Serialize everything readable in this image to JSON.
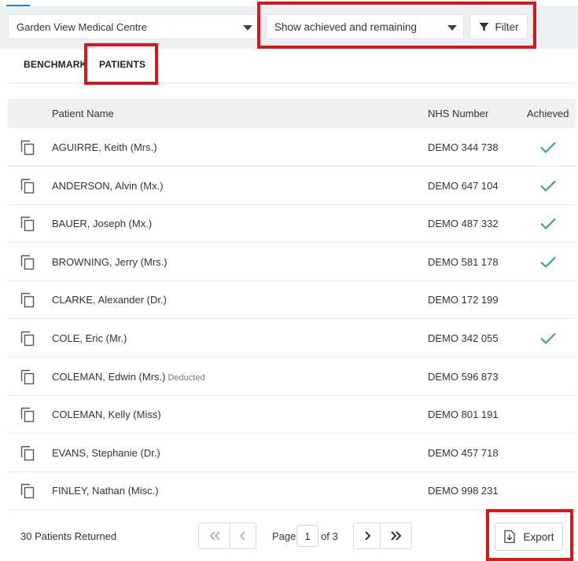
{
  "toolbar": {
    "practice": "Garden View Medical Centre",
    "achieved_filter": "Show achieved and remaining",
    "filter_label": "Filter"
  },
  "tabs": [
    {
      "label": "BENCHMARK"
    },
    {
      "label": "PATIENTS"
    }
  ],
  "table": {
    "columns": [
      "Patient Name",
      "NHS Number",
      "Achieved"
    ],
    "rows": [
      {
        "name": "AGUIRRE, Keith (Mrs.)",
        "note": "",
        "nhs": "DEMO 344 738",
        "achieved": true
      },
      {
        "name": "ANDERSON, Alvin (Mx.)",
        "note": "",
        "nhs": "DEMO 647 104",
        "achieved": true
      },
      {
        "name": "BAUER, Joseph (Mx.)",
        "note": "",
        "nhs": "DEMO 487 332",
        "achieved": true
      },
      {
        "name": "BROWNING, Jerry (Mrs.)",
        "note": "",
        "nhs": "DEMO 581 178",
        "achieved": true
      },
      {
        "name": "CLARKE, Alexander (Dr.)",
        "note": "",
        "nhs": "DEMO 172 199",
        "achieved": false
      },
      {
        "name": "COLE, Eric (Mr.)",
        "note": "",
        "nhs": "DEMO 342 055",
        "achieved": true
      },
      {
        "name": "COLEMAN, Edwin (Mrs.)",
        "note": "Deducted",
        "nhs": "DEMO 596 873",
        "achieved": false
      },
      {
        "name": "COLEMAN, Kelly (Miss)",
        "note": "",
        "nhs": "DEMO 801 191",
        "achieved": false
      },
      {
        "name": "EVANS, Stephanie (Dr.)",
        "note": "",
        "nhs": "DEMO 457 718",
        "achieved": false
      },
      {
        "name": "FINLEY, Nathan (Misc.)",
        "note": "",
        "nhs": "DEMO 998 231",
        "achieved": false
      }
    ]
  },
  "footer": {
    "count_text": "30 Patients Returned",
    "page_label": "Page",
    "page_current": "1",
    "page_of": "of 3",
    "export_label": "Export"
  },
  "colors": {
    "check": "#3aaa5c",
    "highlight": "#d9161c",
    "accent": "#2f7ec7"
  },
  "icons": {
    "copy": "copy-icon",
    "check": "check-icon",
    "filter": "filter-icon",
    "export": "export-icon",
    "caret": "caret-down-icon"
  }
}
